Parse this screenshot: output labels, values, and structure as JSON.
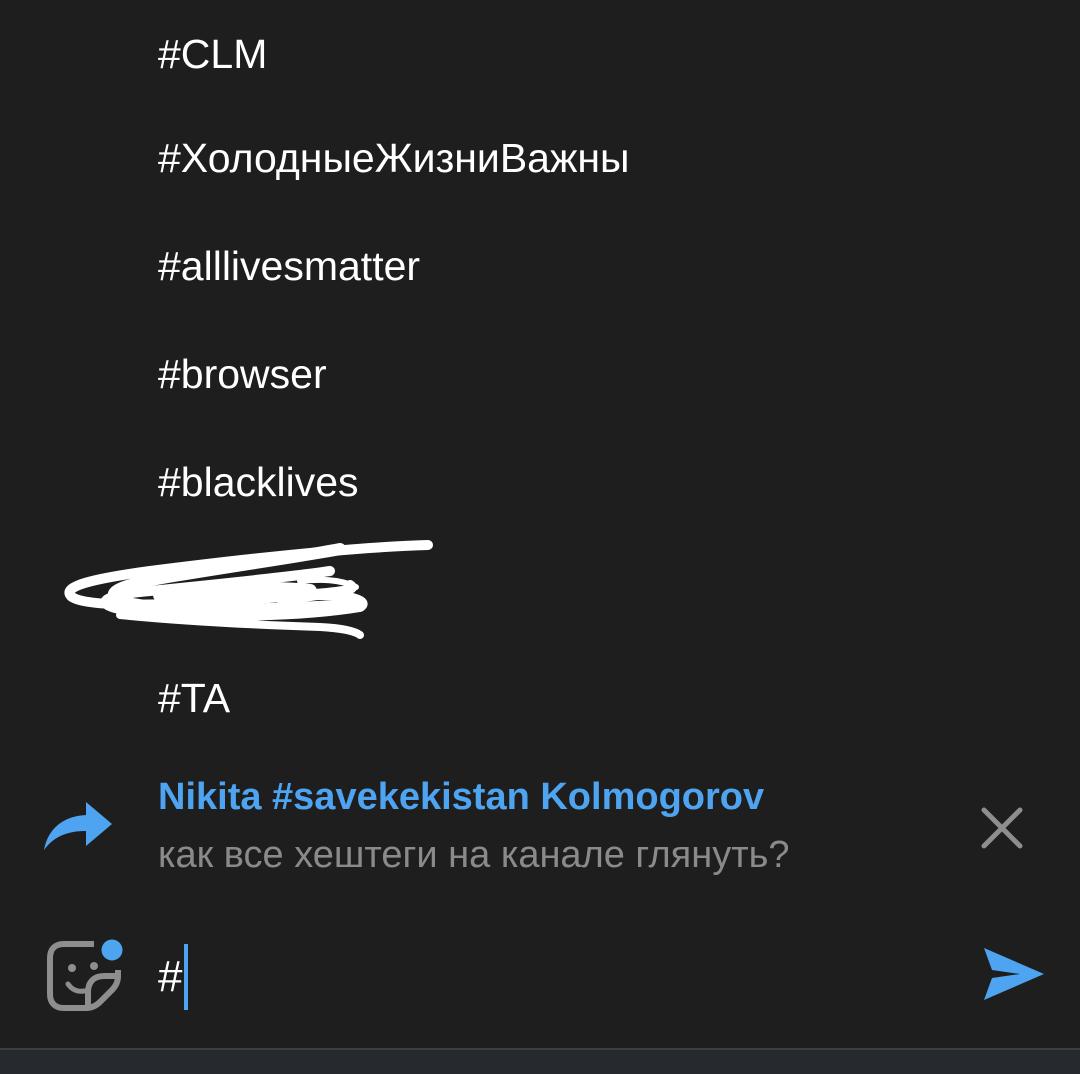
{
  "hashtags": [
    {
      "label": "#CLM"
    },
    {
      "label": "#ХолодныеЖизниВажны"
    },
    {
      "label": "#alllivesmatter"
    },
    {
      "label": "#browser"
    },
    {
      "label": "#blacklives"
    },
    {
      "label": ""
    },
    {
      "label": "#TA"
    }
  ],
  "reply": {
    "icon": "reply-arrow-icon",
    "author": "Nikita #savekekistan Kolmogorov",
    "text": "как все хештеги на канале глянуть?",
    "close_icon": "close-icon"
  },
  "composer": {
    "sticker_icon": "sticker-icon",
    "value": "#",
    "send_icon": "send-icon"
  },
  "colors": {
    "background": "#1e1e1e",
    "accent": "#4ea4f0",
    "secondary_text": "#8a8a8a",
    "icon_gray": "#8e8e8e"
  }
}
